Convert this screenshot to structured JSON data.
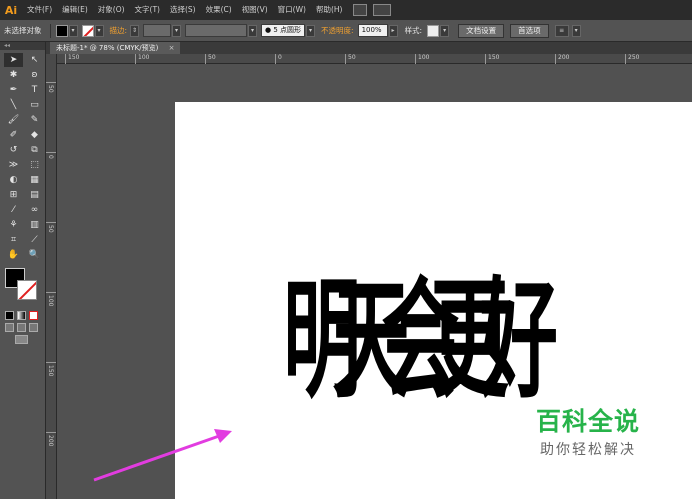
{
  "app": {
    "logo": "Ai"
  },
  "menu": [
    "文件(F)",
    "编辑(E)",
    "对象(O)",
    "文字(T)",
    "选择(S)",
    "效果(C)",
    "视图(V)",
    "窗口(W)",
    "帮助(H)"
  ],
  "control_bar": {
    "selection_status": "未选择对象",
    "stroke_label": "描边:",
    "brush_label": "5 点圆形",
    "opacity_label": "不透明度:",
    "opacity_value": "100%",
    "style_label": "样式:",
    "doc_setup_button": "文档设置",
    "preferences_button": "首选项",
    "colors": {
      "fill": "#000000",
      "accent": "#f0a030"
    }
  },
  "document_tab": {
    "title": "未标题-1* @ 78% (CMYK/预览)",
    "close": "×"
  },
  "ruler": {
    "horizontal_labels": [
      "150",
      "100",
      "50",
      "0",
      "50",
      "100",
      "150",
      "200",
      "250"
    ],
    "vertical_labels": [
      "50",
      "0",
      "50",
      "100",
      "150",
      "200"
    ]
  },
  "artboard": {
    "text": "明天会更好"
  },
  "watermark": {
    "title": "百科全说",
    "subtitle": "助你轻松解决",
    "color": "#27b34a"
  },
  "annotation": {
    "arrow_color": "#e23ce0"
  },
  "tools": [
    "selection-tool",
    "direct-selection-tool",
    "magic-wand-tool",
    "lasso-tool",
    "pen-tool",
    "type-tool",
    "line-segment-tool",
    "rectangle-tool",
    "paintbrush-tool",
    "pencil-tool",
    "blob-brush-tool",
    "eraser-tool",
    "rotate-tool",
    "scale-tool",
    "width-tool",
    "free-transform-tool",
    "shape-builder-tool",
    "perspective-grid-tool",
    "mesh-tool",
    "gradient-tool",
    "eyedropper-tool",
    "blend-tool",
    "symbol-sprayer-tool",
    "column-graph-tool",
    "artboard-tool",
    "slice-tool",
    "hand-tool",
    "zoom-tool"
  ]
}
